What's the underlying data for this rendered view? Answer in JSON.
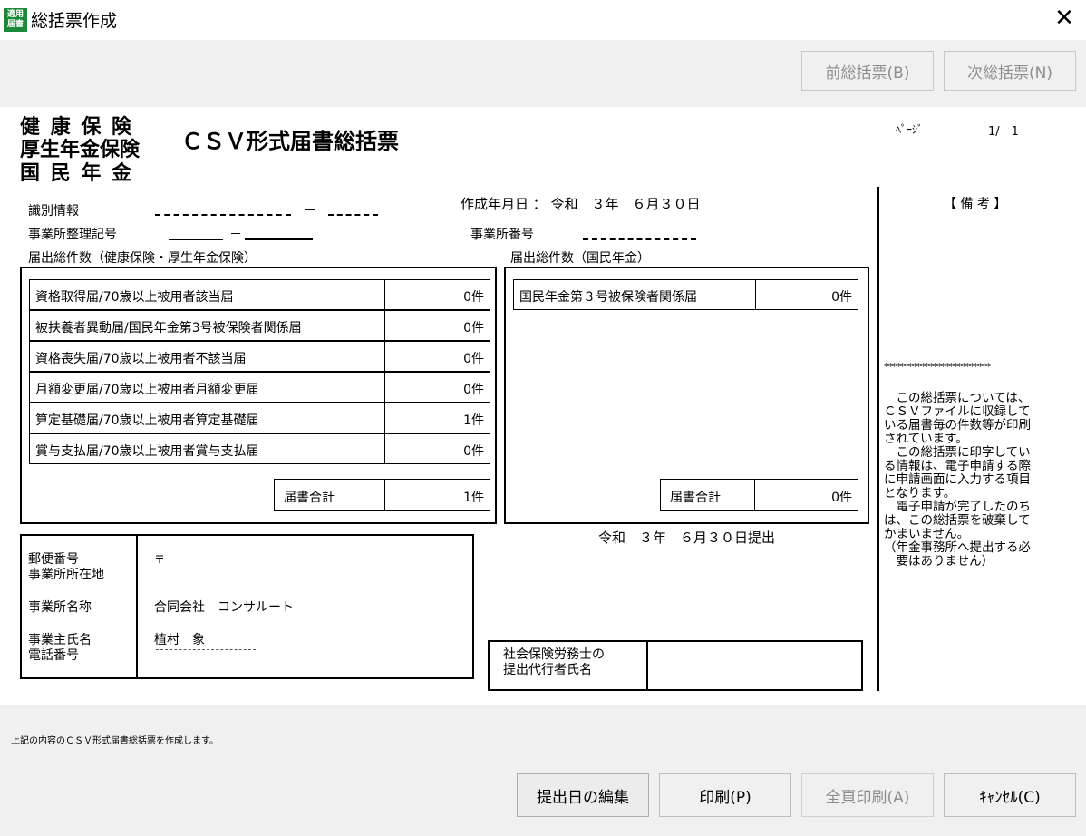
{
  "window": {
    "icon_text": "適用届書",
    "title": "総括票作成",
    "close_label": "✕"
  },
  "toolbar": {
    "prev_label": "前総括票(B)",
    "next_label": "次総括票(N)"
  },
  "document": {
    "insurance_types": [
      "健 康 保 険",
      "厚生年金保険",
      "国 民 年 金"
    ],
    "doc_title": "ＣＳＶ形式届書総括票",
    "page_label": "ﾍﾟｰｼﾞ",
    "page_value": "1/　1",
    "id_label": "識別情報",
    "id_sep": "－",
    "created_label": "作成年月日 ： 令和　３年　６月３０日",
    "office_code_label": "事業所整理記号",
    "office_code_value": "＿＿＿＿",
    "office_code_sep": "－",
    "office_number_label": "事業所番号",
    "kenpo_header": "届出総件数（健康保険・厚生年金保険）",
    "kenpo_rows": [
      {
        "label": "資格取得届/70歳以上被用者該当届",
        "count": "0件"
      },
      {
        "label": "被扶養者異動届/国民年金第3号被保険者関係届",
        "count": "0件"
      },
      {
        "label": "資格喪失届/70歳以上被用者不該当届",
        "count": "0件"
      },
      {
        "label": "月額変更届/70歳以上被用者月額変更届",
        "count": "0件"
      },
      {
        "label": "算定基礎届/70歳以上被用者算定基礎届",
        "count": "1件"
      },
      {
        "label": "賞与支払届/70歳以上被用者賞与支払届",
        "count": "0件"
      }
    ],
    "kenpo_total_label": "届書合計",
    "kenpo_total_value": "1件",
    "kokumin_header": "届出総件数（国民年金）",
    "kokumin_rows": [
      {
        "label": "国民年金第３号被保険者関係届",
        "count": "0件"
      }
    ],
    "kokumin_total_label": "届書合計",
    "kokumin_total_value": "0件",
    "submit_date": "令和　３年　６月３０日提出",
    "postal_label": "郵便番号",
    "address_label": "事業所所在地",
    "postal_value": "〒",
    "office_name_label": "事業所名称",
    "office_name_value": "合同会社　コンサルート",
    "owner_label": "事業主氏名",
    "phone_label": "電話番号",
    "owner_value": "植村　象",
    "agent_label_1": "社会保険労務士の",
    "agent_label_2": "提出代行者氏名",
    "remarks_header": "【 備 考 】",
    "remarks_stars": "**************************",
    "remarks_lines": [
      "　この総括票については、",
      "ＣＳＶファイルに収録して",
      "いる届書毎の件数等が印刷",
      "されています。",
      "　この総括票に印字してい",
      "る情報は、電子申請する際",
      "に申請画面に入力する項目",
      "となります。",
      "　電子申請が完了したのち",
      "は、この総括票を破棄して",
      "かまいません。",
      "（年金事務所へ提出する必",
      "　要はありません）"
    ]
  },
  "footer": {
    "message": "上記の内容のＣＳＶ形式届書総括票を作成します。",
    "edit_date_label": "提出日の編集",
    "print_label": "印刷(P)",
    "print_all_label": "全頁印刷(A)",
    "cancel_label": "ｷｬﾝｾﾙ(C)"
  }
}
